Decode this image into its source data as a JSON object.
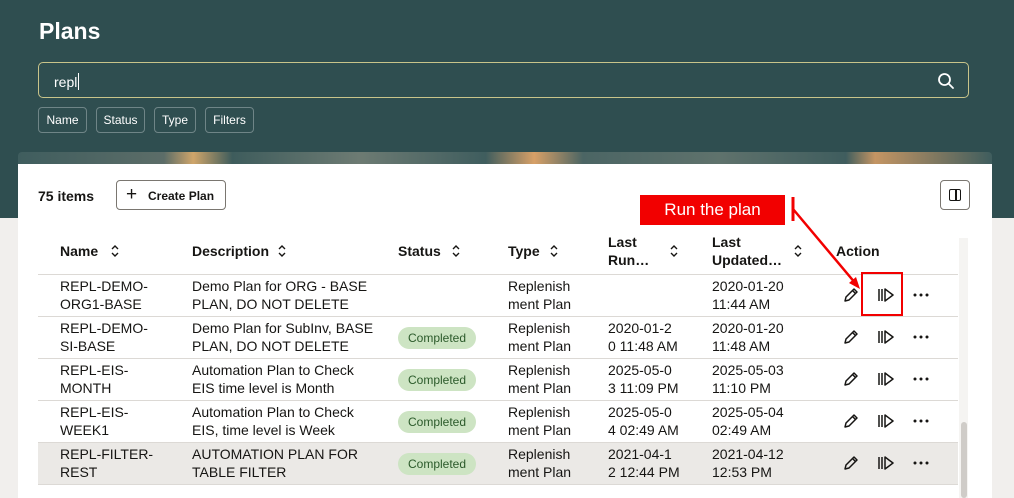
{
  "header": {
    "title": "Plans",
    "search_value": "repl",
    "filters": [
      "Name",
      "Status",
      "Type",
      "Filters"
    ]
  },
  "toolbar": {
    "item_count": "75 items",
    "create_label": "Create Plan"
  },
  "columns": {
    "name": "Name",
    "description": "Description",
    "status": "Status",
    "type": "Type",
    "last_run_1": "Last",
    "last_run_2": "Run…",
    "last_updated_1": "Last",
    "last_updated_2": "Updated…",
    "action": "Action"
  },
  "rows": [
    {
      "name1": "REPL-DEMO-",
      "name2": "ORG1-BASE",
      "desc1": "Demo Plan for ORG - BASE",
      "desc2": "PLAN, DO NOT DELETE",
      "status": "",
      "type1": "Replenish",
      "type2": "ment Plan",
      "run1": "",
      "run2": "",
      "upd1": "2020-01-20",
      "upd2": "11:44 AM"
    },
    {
      "name1": "REPL-DEMO-",
      "name2": "SI-BASE",
      "desc1": "Demo Plan for SubInv, BASE",
      "desc2": "PLAN, DO NOT DELETE",
      "status": "Completed",
      "type1": "Replenish",
      "type2": "ment Plan",
      "run1": "2020-01-2",
      "run2": "0 11:48 AM",
      "upd1": "2020-01-20",
      "upd2": "11:48 AM"
    },
    {
      "name1": "REPL-EIS-",
      "name2": "MONTH",
      "desc1": "Automation Plan to Check",
      "desc2": "EIS time level is Month",
      "status": "Completed",
      "type1": "Replenish",
      "type2": "ment Plan",
      "run1": "2025-05-0",
      "run2": "3 11:09 PM",
      "upd1": "2025-05-03",
      "upd2": "11:10 PM"
    },
    {
      "name1": "REPL-EIS-",
      "name2": "WEEK1",
      "desc1": "Automation Plan to Check",
      "desc2": "EIS, time level is Week",
      "status": "Completed",
      "type1": "Replenish",
      "type2": "ment Plan",
      "run1": "2025-05-0",
      "run2": "4 02:49 AM",
      "upd1": "2025-05-04",
      "upd2": "02:49 AM"
    },
    {
      "name1": "REPL-FILTER-",
      "name2": "REST",
      "desc1": "AUTOMATION PLAN FOR",
      "desc2": "TABLE FILTER",
      "status": "Completed",
      "type1": "Replenish",
      "type2": "ment Plan",
      "run1": "2021-04-1",
      "run2": "2 12:44 PM",
      "upd1": "2021-04-12",
      "upd2": "12:53 PM"
    }
  ],
  "annotation": {
    "callout": "Run the plan",
    "color": "#f20000"
  }
}
